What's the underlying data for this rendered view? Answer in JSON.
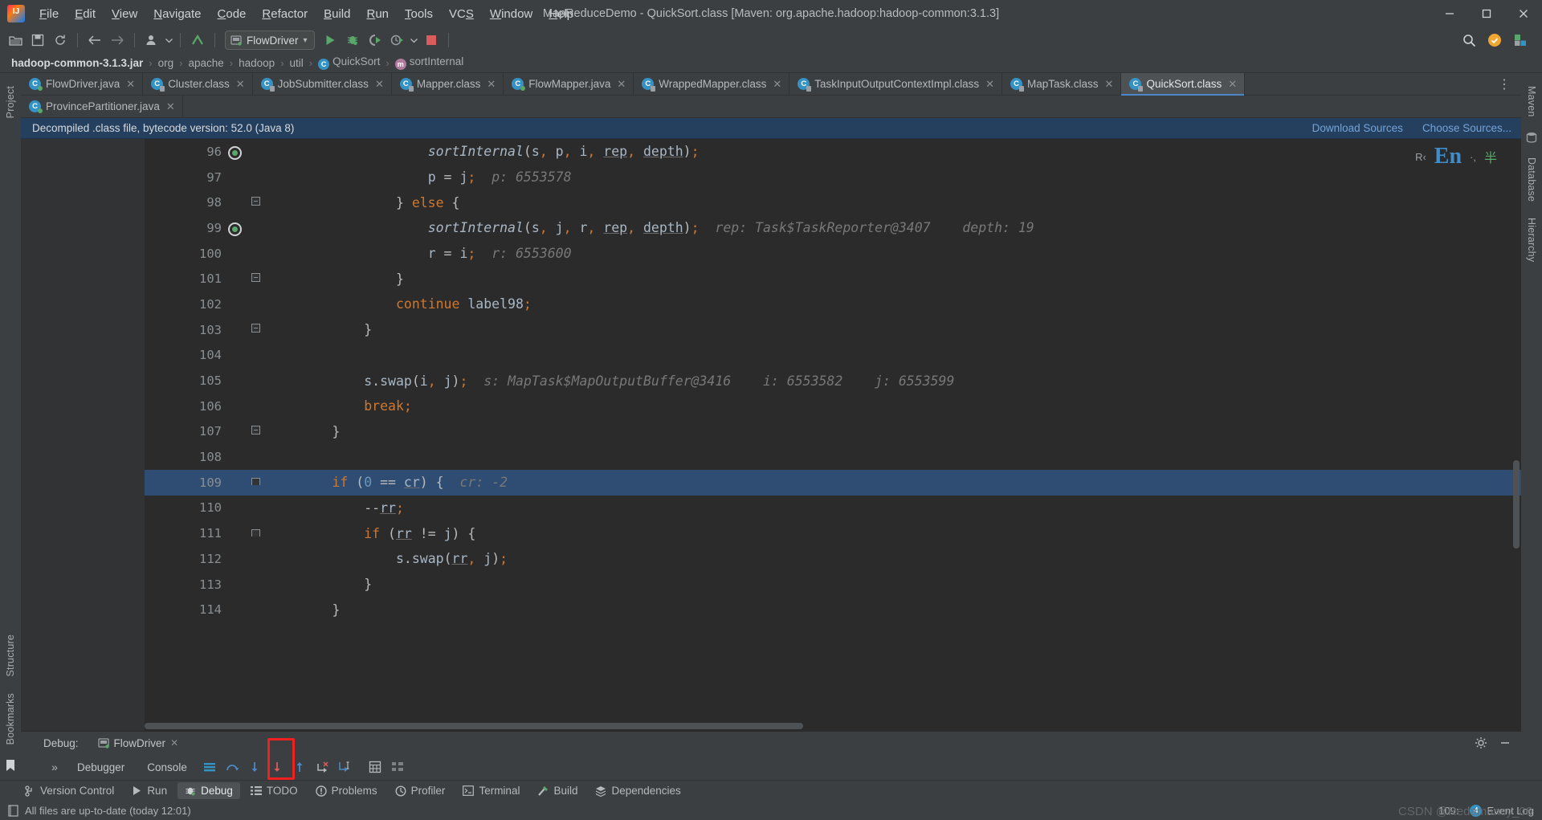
{
  "window": {
    "title": "MapReduceDemo - QuickSort.class [Maven: org.apache.hadoop:hadoop-common:3.1.3]",
    "minimize": "—",
    "maximize": "▢",
    "close": "✕"
  },
  "menubar": {
    "items": [
      {
        "label": "File",
        "mnemonic": "F"
      },
      {
        "label": "Edit",
        "mnemonic": "E"
      },
      {
        "label": "View",
        "mnemonic": "V"
      },
      {
        "label": "Navigate",
        "mnemonic": "N"
      },
      {
        "label": "Code",
        "mnemonic": "C"
      },
      {
        "label": "Refactor",
        "mnemonic": "R"
      },
      {
        "label": "Build",
        "mnemonic": "B"
      },
      {
        "label": "Run",
        "mnemonic": "R"
      },
      {
        "label": "Tools",
        "mnemonic": "T"
      },
      {
        "label": "VCS",
        "mnemonic": "S"
      },
      {
        "label": "Window",
        "mnemonic": "W"
      },
      {
        "label": "Help",
        "mnemonic": "H"
      }
    ]
  },
  "toolbar": {
    "open_project": "open-folder-icon",
    "save_all": "save-icon",
    "sync": "refresh-icon",
    "back": "back-arrow-icon",
    "forward": "forward-arrow-icon",
    "profile": "user-icon",
    "updates": "update-arrow-icon",
    "run_config_label": "FlowDriver",
    "run_config_caret": "▾",
    "run": "run-icon",
    "debug": "debug-icon",
    "run_coverage": "run-with-coverage-icon",
    "profiler": "profiler-icon",
    "stop": "stop-icon",
    "search": "search-icon",
    "notifications": "notification-icon",
    "ide_plugin": "plugin-icon"
  },
  "breadcrumb": {
    "items": [
      {
        "label": "hadoop-common-3.1.3.jar",
        "icon": "",
        "bold": true
      },
      {
        "label": "org",
        "icon": "",
        "bold": false
      },
      {
        "label": "apache",
        "icon": "",
        "bold": false
      },
      {
        "label": "hadoop",
        "icon": "",
        "bold": false
      },
      {
        "label": "util",
        "icon": "",
        "bold": false
      },
      {
        "label": "QuickSort",
        "icon": "class-icon",
        "bold": false
      },
      {
        "label": "sortInternal",
        "icon": "method-icon",
        "bold": false
      }
    ],
    "separator": "›"
  },
  "editor_tabs": {
    "row1": [
      {
        "label": "FlowDriver.java",
        "icon": "java-file-icon",
        "active": false,
        "closable": true
      },
      {
        "label": "Cluster.class",
        "icon": "class-file-icon",
        "active": false,
        "closable": true
      },
      {
        "label": "JobSubmitter.class",
        "icon": "class-file-icon",
        "active": false,
        "closable": true
      },
      {
        "label": "Mapper.class",
        "icon": "class-file-icon",
        "active": false,
        "closable": true
      },
      {
        "label": "FlowMapper.java",
        "icon": "java-file-icon",
        "active": false,
        "closable": true
      },
      {
        "label": "WrappedMapper.class",
        "icon": "class-file-icon",
        "active": false,
        "closable": true
      },
      {
        "label": "TaskInputOutputContextImpl.class",
        "icon": "class-file-icon",
        "active": false,
        "closable": true
      },
      {
        "label": "MapTask.class",
        "icon": "class-file-icon",
        "active": false,
        "closable": true
      },
      {
        "label": "QuickSort.class",
        "icon": "class-file-icon",
        "active": true,
        "closable": true
      }
    ],
    "row2": [
      {
        "label": "ProvincePartitioner.java",
        "icon": "java-file-icon",
        "active": false,
        "closable": true
      }
    ],
    "more_icon": "vertical-dots-icon"
  },
  "notification": {
    "message": "Decompiled .class file, bytecode version: 52.0 (Java 8)",
    "download_sources": "Download Sources",
    "choose_sources": "Choose Sources..."
  },
  "editor": {
    "hud_keymap": "R‹",
    "hud_lang": "En",
    "hud_sep": "·,",
    "hud_extra": "半",
    "lines": [
      {
        "num": "96",
        "marker": "exec-current",
        "fold": "",
        "code": "                    sortInternal(s, p, i, rep, depth);",
        "hint": "",
        "current": false
      },
      {
        "num": "97",
        "marker": "",
        "fold": "",
        "code": "                    p = j;",
        "hint": "p: 6553578",
        "current": false
      },
      {
        "num": "98",
        "marker": "",
        "fold": "fold-box",
        "code": "                } else {",
        "hint": "",
        "current": false
      },
      {
        "num": "99",
        "marker": "exec-frame",
        "fold": "",
        "code": "                    sortInternal(s, j, r, rep, depth);",
        "hint": "rep: Task$TaskReporter@3407    depth: 19",
        "current": false
      },
      {
        "num": "100",
        "marker": "",
        "fold": "",
        "code": "                    r = i;",
        "hint": "r: 6553600",
        "current": false
      },
      {
        "num": "101",
        "marker": "",
        "fold": "fold-box",
        "code": "                }",
        "hint": "",
        "current": false
      },
      {
        "num": "102",
        "marker": "",
        "fold": "",
        "code": "                continue label98;",
        "hint": "",
        "current": false
      },
      {
        "num": "103",
        "marker": "",
        "fold": "fold-box",
        "code": "            }",
        "hint": "",
        "current": false
      },
      {
        "num": "104",
        "marker": "",
        "fold": "",
        "code": "",
        "hint": "",
        "current": false
      },
      {
        "num": "105",
        "marker": "",
        "fold": "",
        "code": "            s.swap(i, j);",
        "hint": "s: MapTask$MapOutputBuffer@3416    i: 6553582    j: 6553599",
        "current": false
      },
      {
        "num": "106",
        "marker": "",
        "fold": "",
        "code": "            break;",
        "hint": "",
        "current": false
      },
      {
        "num": "107",
        "marker": "",
        "fold": "fold-box",
        "code": "        }",
        "hint": "",
        "current": false
      },
      {
        "num": "108",
        "marker": "",
        "fold": "",
        "code": "",
        "hint": "",
        "current": false
      },
      {
        "num": "109",
        "marker": "",
        "fold": "fold-end",
        "code": "        if (0 == cr) {",
        "hint": "cr: -2",
        "current": true
      },
      {
        "num": "110",
        "marker": "",
        "fold": "",
        "code": "            --rr;",
        "hint": "",
        "current": false
      },
      {
        "num": "111",
        "marker": "",
        "fold": "fold-end",
        "code": "            if (rr != j) {",
        "hint": "",
        "current": false
      },
      {
        "num": "112",
        "marker": "",
        "fold": "",
        "code": "                s.swap(rr, j);",
        "hint": "",
        "current": false
      },
      {
        "num": "113",
        "marker": "",
        "fold": "",
        "code": "            }",
        "hint": "",
        "current": false
      },
      {
        "num": "114",
        "marker": "",
        "fold": "",
        "code": "        }",
        "hint": "",
        "current": false
      }
    ]
  },
  "debug_panel": {
    "title": "Debug:",
    "session": "FlowDriver",
    "session_close": "✕",
    "settings_icon": "gear-icon",
    "hide_icon": "minimize-icon",
    "expand_icon": "chevrons-icon",
    "tabs": [
      {
        "label": "Debugger",
        "active": true
      },
      {
        "label": "Console",
        "active": false
      }
    ],
    "tools": [
      {
        "name": "show-execution-point-icon",
        "glyph": "execution-point"
      },
      {
        "name": "step-over-icon",
        "glyph": "step-over"
      },
      {
        "name": "step-into-icon",
        "glyph": "step-into"
      },
      {
        "name": "force-step-into-icon",
        "glyph": "force-step-into"
      },
      {
        "name": "step-out-icon",
        "glyph": "step-out",
        "highlighted": true
      },
      {
        "name": "drop-frame-icon",
        "glyph": "drop-frame"
      },
      {
        "name": "run-to-cursor-icon",
        "glyph": "run-to-cursor"
      },
      {
        "name": "evaluate-expression-icon",
        "glyph": "evaluate"
      },
      {
        "name": "layout-settings-icon",
        "glyph": "layout"
      }
    ]
  },
  "bottom_bar": {
    "items": [
      {
        "label": "Version Control",
        "icon": "branch-icon",
        "active": false
      },
      {
        "label": "Run",
        "icon": "run-icon",
        "active": false
      },
      {
        "label": "Debug",
        "icon": "debug-icon",
        "active": true
      },
      {
        "label": "TODO",
        "icon": "todo-icon",
        "active": false
      },
      {
        "label": "Problems",
        "icon": "problems-icon",
        "active": false
      },
      {
        "label": "Profiler",
        "icon": "profiler-icon",
        "active": false
      },
      {
        "label": "Terminal",
        "icon": "terminal-icon",
        "active": false
      },
      {
        "label": "Build",
        "icon": "build-icon",
        "active": false
      },
      {
        "label": "Dependencies",
        "icon": "dependencies-icon",
        "active": false
      }
    ]
  },
  "status_bar": {
    "message": "All files are up-to-date (today 12:01)",
    "message_icon": "document-icon",
    "caret_position": "109:",
    "event_log": "Event Log",
    "event_log_count": "4",
    "watermark": "CSDN @Redamancy_06"
  },
  "left_rail": {
    "project_label": "Project",
    "structure_label": "Structure",
    "bookmarks_label": "Bookmarks",
    "bookmark_icon": "bookmark-icon"
  },
  "right_rail": {
    "maven_label": "Maven",
    "database_label": "Database",
    "hierarchy_label": "Hierarchy",
    "maven_icon": "maven-icon",
    "database_icon": "database-icon"
  },
  "colors": {
    "accent": "#4a88c7",
    "selection": "#2f4d73",
    "notification_bg": "#25405f",
    "keyword": "#cc7832",
    "number": "#6897bb",
    "text": "#a9b7c6",
    "hint": "#787878",
    "highlight_box": "#f02020"
  }
}
